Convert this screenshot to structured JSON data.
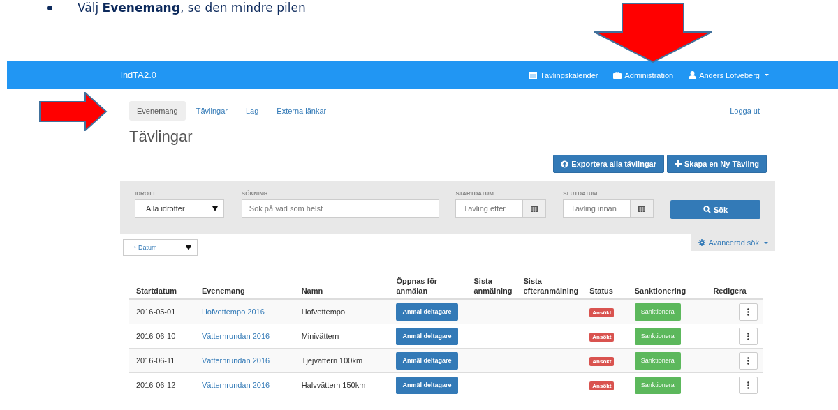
{
  "document": {
    "instruction": "Välj **Evenemang**, se den mindre pilen"
  },
  "navbar": {
    "brand": "indTA2.0",
    "links": [
      {
        "kind": "calendar",
        "label": "Tävlingskalender"
      },
      {
        "kind": "briefcase",
        "label": "Administration"
      },
      {
        "kind": "user",
        "label": "Anders Löfveberg",
        "dropdown": true
      }
    ]
  },
  "subnav": {
    "tabs": [
      {
        "label": "Evenemang",
        "selected": true
      },
      {
        "label": "Tävlingar",
        "selected": false
      },
      {
        "label": "Lag",
        "selected": false
      },
      {
        "label": "Externa länkar",
        "selected": false
      }
    ],
    "logout": "Logga ut"
  },
  "page_title": "Tävlingar",
  "actions": [
    {
      "kind": "export",
      "label": "Exportera alla tävlingar"
    },
    {
      "kind": "create",
      "label": "Skapa en Ny Tävling"
    }
  ],
  "filters": [
    {
      "kind": "select",
      "label": "IDROTT",
      "value": "Alla idrotter"
    },
    {
      "kind": "text",
      "label": "SÖKNING",
      "placeholder": "Sök på vad som helst"
    },
    {
      "kind": "date",
      "label": "STARTDATUM",
      "placeholder": "Tävling efter"
    },
    {
      "kind": "date",
      "label": "SLUTDATUM",
      "placeholder": "Tävling innan"
    }
  ],
  "search_button": "Sök",
  "sort": {
    "value": "↑ Datum"
  },
  "advanced_search": "Avancerad sök",
  "table": {
    "columns": [
      "Startdatum",
      "Evenemang",
      "Namn",
      "Öppnas för anmälan",
      "Sista anmälning",
      "Sista efteranmälning",
      "Status",
      "Sanktionering",
      "Redigera"
    ],
    "rows": [
      {
        "date": "2016-05-01",
        "event": "Hofvettempo 2016",
        "name": "Hofvettempo",
        "register": "Anmäl deltagare",
        "status": "Ansökt",
        "sanction": "Sanktionera"
      },
      {
        "date": "2016-06-10",
        "event": "Vätternrundan 2016",
        "name": "Minivättern",
        "register": "Anmäl deltagare",
        "status": "Ansökt",
        "sanction": "Sanktionera"
      },
      {
        "date": "2016-06-11",
        "event": "Vätternrundan 2016",
        "name": "Tjejvättern 100km",
        "register": "Anmäl deltagare",
        "status": "Ansökt",
        "sanction": "Sanktionera"
      },
      {
        "date": "2016-06-12",
        "event": "Vätternrundan 2016",
        "name": "Halvvättern 150km",
        "register": "Anmäl deltagare",
        "status": "Ansökt",
        "sanction": "Sanktionera"
      }
    ]
  }
}
